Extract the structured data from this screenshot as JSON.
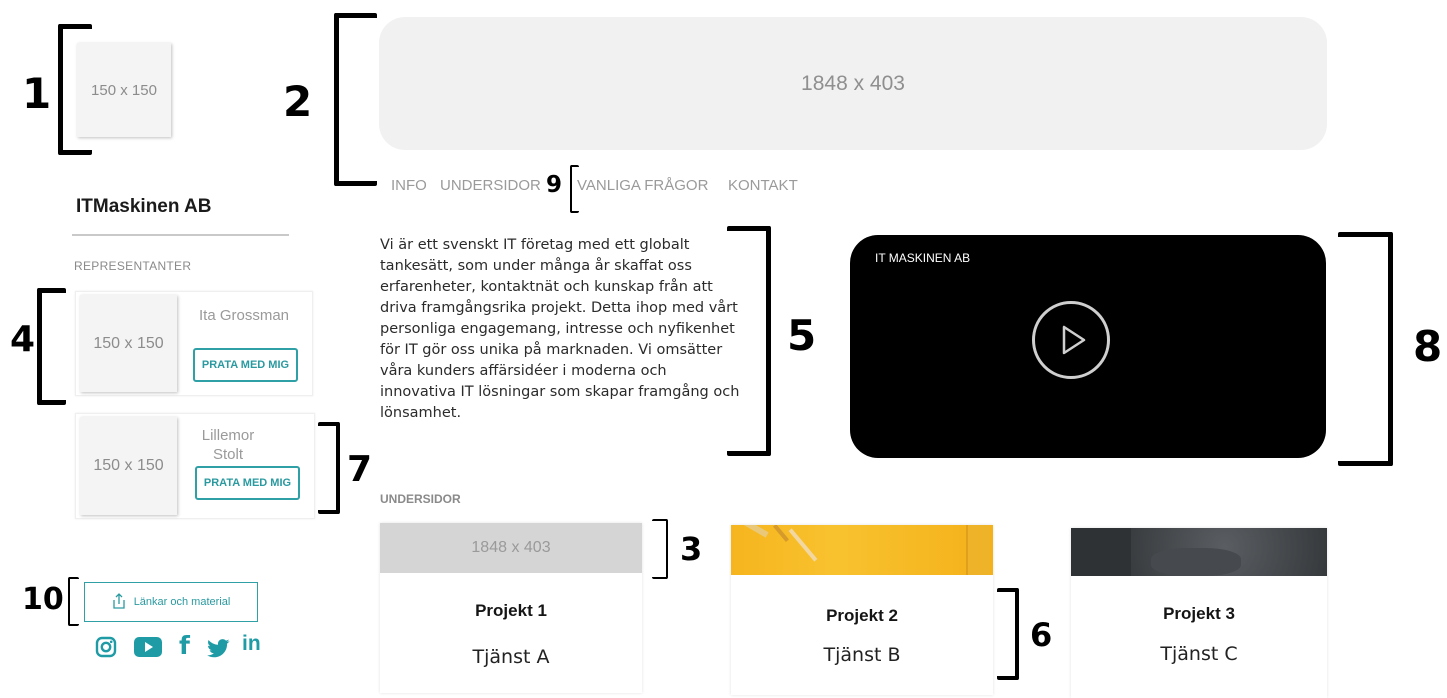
{
  "logo": {
    "placeholder": "150 x 150"
  },
  "company_name": "ITMaskinen AB",
  "representatives": {
    "title": "REPRESENTANTER",
    "people": [
      {
        "placeholder": "150 x 150",
        "name": "Ita Grossman",
        "button": "PRATA MED MIG"
      },
      {
        "placeholder": "150 x 150",
        "name": "Lillemor Stolt",
        "button": "PRATA MED MIG"
      }
    ]
  },
  "links_button": {
    "label": "Länkar och material",
    "icon": "share-icon"
  },
  "social": [
    {
      "icon": "instagram-icon"
    },
    {
      "icon": "youtube-icon"
    },
    {
      "icon": "facebook-icon",
      "glyph": "f"
    },
    {
      "icon": "twitter-icon"
    },
    {
      "icon": "linkedin-icon",
      "glyph": "in"
    }
  ],
  "banner": {
    "placeholder": "1848 x 403"
  },
  "nav": {
    "items": [
      "INFO",
      "UNDERSIDOR",
      "VANLIGA FRÅGOR",
      "KONTAKT"
    ]
  },
  "intro_text": "Vi är ett svenskt IT företag med ett globalt tankesätt, som under många år skaffat oss erfarenheter, kontaktnät och kunskap från att driva framgångsrika projekt. Detta ihop med vårt personliga engagemang, intresse och nyfikenhet för IT gör oss unika på marknaden. Vi omsätter våra kunders affärsidéer i moderna och innovativa IT lösningar som skapar framgång och lönsamhet.",
  "video": {
    "title": "IT MASKINEN AB"
  },
  "subpages": {
    "title": "UNDERSIDOR",
    "cards": [
      {
        "image_placeholder": "1848 x 403",
        "name": "Projekt 1",
        "service": "Tjänst A"
      },
      {
        "name": "Projekt 2",
        "service": "Tjänst B"
      },
      {
        "name": "Projekt 3",
        "service": "Tjänst C"
      }
    ]
  },
  "annotations": [
    "1",
    "2",
    "3",
    "4",
    "5",
    "6",
    "7",
    "8",
    "9",
    "10"
  ],
  "colors": {
    "accent": "#2fa0a6",
    "placeholder_bg": "#f4f4f4",
    "video_bg": "#000000"
  }
}
